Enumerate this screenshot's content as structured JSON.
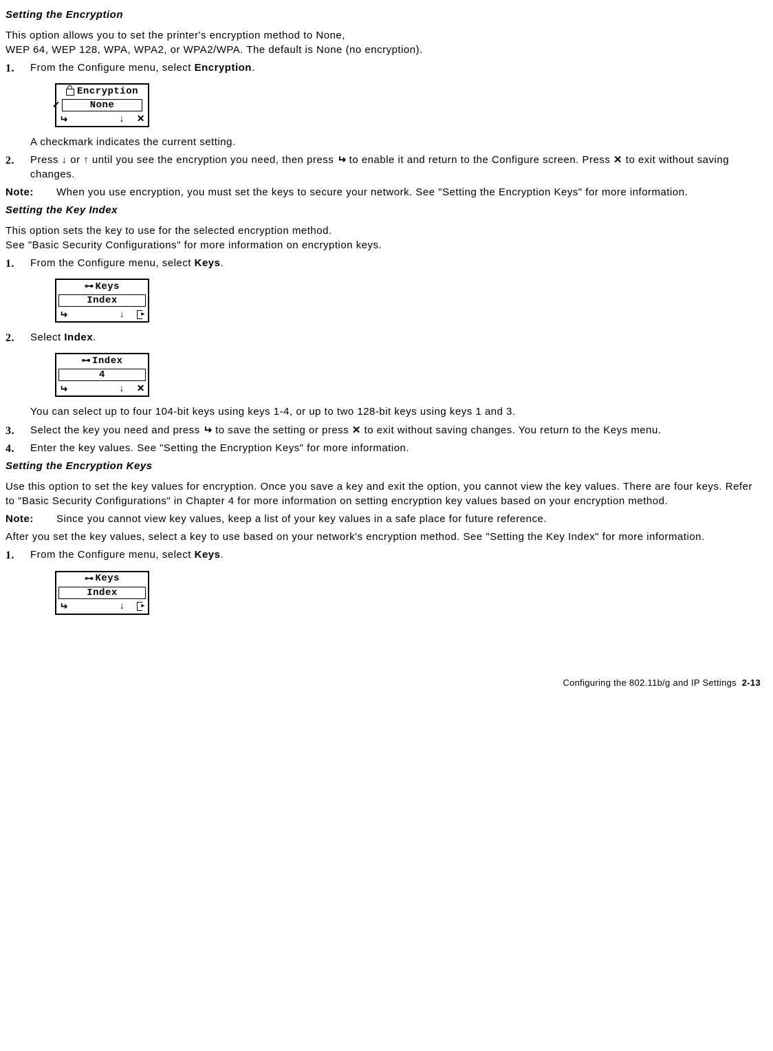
{
  "sec1": {
    "title": "Setting the Encryption",
    "intro1": "This option allows you to set the printer's encryption method to None,",
    "intro2": "WEP 64, WEP 128, WPA, WPA2, or WPA2/WPA. The default is None (no encryption).",
    "step1_a": "From the Configure menu, select ",
    "step1_b": "Encryption",
    "step1_c": ".",
    "lcd_top": "Encryption",
    "lcd_mid": "None",
    "after_lcd": "A checkmark indicates the current setting.",
    "step2_a": "Press ",
    "step2_b": " or ",
    "step2_c": " until you see the encryption you need, then press ",
    "step2_d": " to enable it and return to the Configure screen. Press ",
    "step2_e": " to exit without saving changes.",
    "note_label": "Note:",
    "note_text": "When you use encryption, you must set the keys to secure your network. See \"Setting the Encryption Keys\" for more information."
  },
  "sec2": {
    "title": "Setting the Key Index",
    "intro1": "This option sets the key to use for the selected encryption method.",
    "intro2": "See \"Basic Security Configurations\" for more information on encryption keys.",
    "step1_a": "From the Configure menu, select ",
    "step1_b": "Keys",
    "step1_c": ".",
    "lcd1_top": "Keys",
    "lcd1_mid": "Index",
    "step2_a": "Select ",
    "step2_b": "Index",
    "step2_c": ".",
    "lcd2_top": "Index",
    "lcd2_mid": "4",
    "after_lcd2": "You can select up to four 104-bit keys using keys 1-4, or up to two 128-bit keys using keys 1 and 3.",
    "step3_a": "Select the key you need and press ",
    "step3_b": " to save the setting or press ",
    "step3_c": " to exit without saving changes. You return to the Keys menu.",
    "step4": "Enter the key values. See \"Setting the Encryption Keys\" for more information."
  },
  "sec3": {
    "title": "Setting the Encryption Keys",
    "p1": "Use this option to set the key values for encryption. Once you save a key and exit the option, you cannot view the key values. There are four keys. Refer to \"Basic Security Configurations\" in Chapter 4 for more information on setting encryption key values based on your encryption method.",
    "note_label": "Note:",
    "note_text": "Since you cannot view key values, keep a list of your key values in a safe place for future reference.",
    "p2": "After you set the key values, select a key to use based on your network's encryption method. See \"Setting the Key Index\" for more information.",
    "step1_a": "From the Configure menu, select ",
    "step1_b": "Keys",
    "step1_c": ".",
    "lcd_top": "Keys",
    "lcd_mid": "Index"
  },
  "footer": {
    "text": "Configuring the 802.11b/g and IP Settings",
    "page": "2-13"
  },
  "chart_data": null
}
